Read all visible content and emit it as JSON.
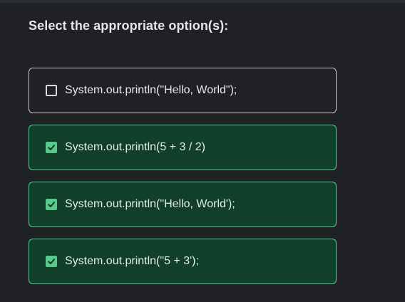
{
  "question": {
    "prompt": "Select the appropriate option(s):"
  },
  "options": [
    {
      "label": "System.out.println(\"Hello, World\");",
      "checked": false
    },
    {
      "label": "System.out.println(5 + 3 / 2)",
      "checked": true
    },
    {
      "label": "System.out.println(\"Hello, World');",
      "checked": true
    },
    {
      "label": "System.out.println(\"5 + 3');",
      "checked": true
    }
  ],
  "colors": {
    "background": "#1f2125",
    "selected_fill": "#10402a",
    "selected_border": "#4fd08a",
    "checkbox_checked": "#57c98a",
    "unselected_border": "#c9ccd1"
  },
  "icons": {
    "checkbox": "checkbox-icon",
    "checkmark": "checkmark-icon"
  }
}
